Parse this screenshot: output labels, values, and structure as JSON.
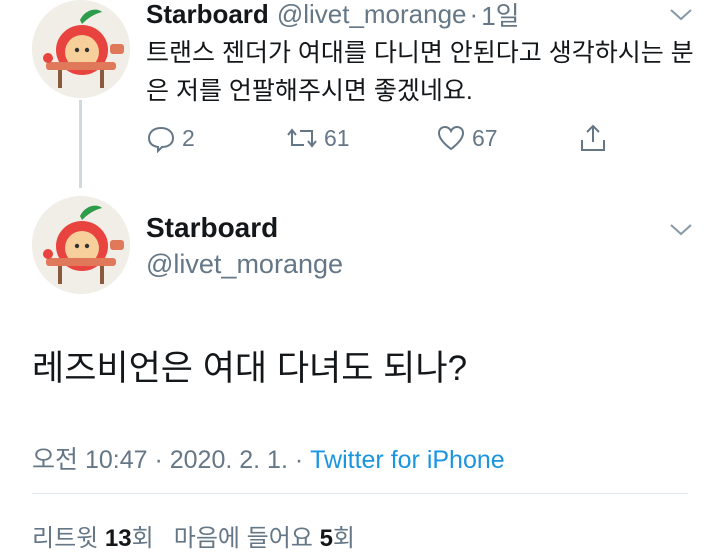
{
  "tweet1": {
    "name": "Starboard",
    "handle": "@livet_morange",
    "separator": "·",
    "time": "1일",
    "text": "트랜스 젠더가 여대를 다니면 안된다고 생각하시는 분은 저를 언팔해주시면 좋겠네요.",
    "reply_count": "2",
    "retweet_count": "61",
    "like_count": "67"
  },
  "tweet2": {
    "name": "Starboard",
    "handle": "@livet_morange",
    "text": "레즈비언은 여대 다녀도 되나?",
    "time": "오전 10:47",
    "date": "2020. 2. 1.",
    "separator": "·",
    "source": "Twitter for iPhone",
    "retweets_label": "리트윗",
    "retweets_count": "13",
    "retweets_unit": "회",
    "likes_label": "마음에 들어요",
    "likes_count": "5",
    "likes_unit": "회"
  },
  "icons": {
    "avatar": "apple-character-avatar",
    "menu": "chevron-down-icon",
    "reply": "reply-icon",
    "retweet": "retweet-icon",
    "like": "heart-icon",
    "share": "share-icon"
  },
  "colors": {
    "text": "#14171a",
    "muted": "#657786",
    "link": "#1b95e0",
    "divider": "#e1e8ed"
  }
}
